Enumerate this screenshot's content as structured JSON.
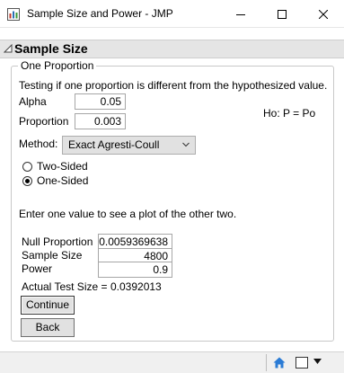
{
  "window": {
    "title": "Sample Size and Power - JMP"
  },
  "outline": {
    "title": "Sample Size"
  },
  "group": {
    "legend": "One Proportion",
    "description": "Testing if one proportion is different from the hypothesized value.",
    "alpha_label": "Alpha",
    "alpha_value": "0.05",
    "proportion_label": "Proportion",
    "proportion_value": "0.003",
    "hypothesis": "Ho: P = Po",
    "method_label": "Method:",
    "method_value": "Exact Agresti-Coull",
    "two_sided_label": "Two-Sided",
    "one_sided_label": "One-Sided",
    "selected_side": "One-Sided",
    "instruction": "Enter one value to see a plot of the other two.",
    "null_proportion_label": "Null Proportion",
    "null_proportion_value": "0.0059369638",
    "sample_size_label": "Sample Size",
    "sample_size_value": "4800",
    "power_label": "Power",
    "power_value": "0.9",
    "actual_test_size_label": "Actual Test Size =",
    "actual_test_size_value": "0.0392013",
    "continue_label": "Continue",
    "back_label": "Back"
  },
  "icons": {
    "app": "jmp-app-icon",
    "minimize": "minimize-icon",
    "maximize": "maximize-icon",
    "close": "close-icon",
    "disclosure": "disclosure-triangle-icon",
    "combo": "chevron-down-icon",
    "home": "home-icon",
    "window": "window-icon",
    "dropdown": "dropdown-arrow-icon"
  },
  "colors": {
    "outline_header_bg": "#e5e5e5",
    "button_bg": "#e1e1e1",
    "home_icon": "#2a7bd5"
  }
}
